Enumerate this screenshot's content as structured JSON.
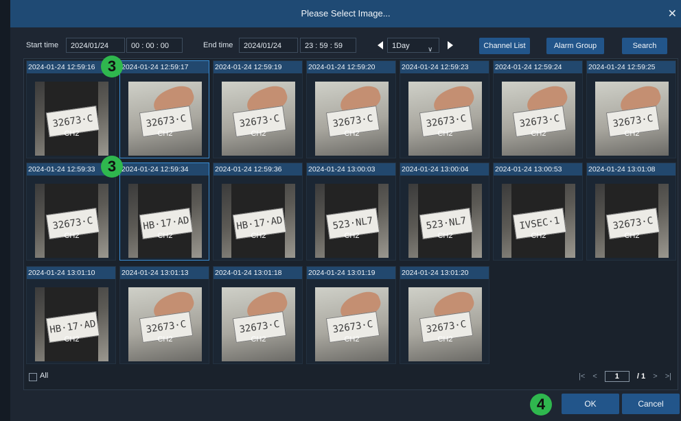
{
  "dialog": {
    "title": "Please Select Image...",
    "close_icon": "close-icon"
  },
  "toolbar": {
    "start_label": "Start time",
    "start_date": "2024/01/24",
    "start_time": "00  :  00  :  00",
    "end_label": "End time",
    "end_date": "2024/01/24",
    "end_time": "23  :  59  :  59",
    "range_value": "1Day",
    "channel_list": "Channel List",
    "alarm_group": "Alarm Group",
    "search": "Search"
  },
  "images": [
    {
      "ts": "2024-01-24 12:59:16",
      "ch": "CH2",
      "plate": "32673·C",
      "scene": "dark"
    },
    {
      "ts": "2024-01-24 12:59:17",
      "ch": "CH2",
      "plate": "32673·C",
      "scene": "light",
      "selected": true
    },
    {
      "ts": "2024-01-24 12:59:19",
      "ch": "CH2",
      "plate": "32673·C",
      "scene": "light"
    },
    {
      "ts": "2024-01-24 12:59:20",
      "ch": "CH2",
      "plate": "32673·C",
      "scene": "light"
    },
    {
      "ts": "2024-01-24 12:59:23",
      "ch": "CH2",
      "plate": "32673·C",
      "scene": "light"
    },
    {
      "ts": "2024-01-24 12:59:24",
      "ch": "CH2",
      "plate": "32673·C",
      "scene": "light"
    },
    {
      "ts": "2024-01-24 12:59:25",
      "ch": "CH2",
      "plate": "32673·C",
      "scene": "light"
    },
    {
      "ts": "2024-01-24 12:59:33",
      "ch": "CH2",
      "plate": "32673·C",
      "scene": "dark"
    },
    {
      "ts": "2024-01-24 12:59:34",
      "ch": "CH2",
      "plate": "HB·17·AD",
      "scene": "dark",
      "selected": true
    },
    {
      "ts": "2024-01-24 12:59:36",
      "ch": "CH2",
      "plate": "HB·17·AD",
      "scene": "dark"
    },
    {
      "ts": "2024-01-24 13:00:03",
      "ch": "CH2",
      "plate": "523·NL7",
      "scene": "dark"
    },
    {
      "ts": "2024-01-24 13:00:04",
      "ch": "CH2",
      "plate": "523·NL7",
      "scene": "dark"
    },
    {
      "ts": "2024-01-24 13:00:53",
      "ch": "CH2",
      "plate": "IVSEC·1",
      "scene": "dark"
    },
    {
      "ts": "2024-01-24 13:01:08",
      "ch": "CH2",
      "plate": "32673·C",
      "scene": "dark"
    },
    {
      "ts": "2024-01-24 13:01:10",
      "ch": "CH2",
      "plate": "HB·17·AD",
      "scene": "dark"
    },
    {
      "ts": "2024-01-24 13:01:13",
      "ch": "CH2",
      "plate": "32673·C",
      "scene": "light"
    },
    {
      "ts": "2024-01-24 13:01:18",
      "ch": "CH2",
      "plate": "32673·C",
      "scene": "light"
    },
    {
      "ts": "2024-01-24 13:01:19",
      "ch": "CH2",
      "plate": "32673·C",
      "scene": "light"
    },
    {
      "ts": "2024-01-24 13:01:20",
      "ch": "CH2",
      "plate": "32673·C",
      "scene": "light"
    }
  ],
  "footer": {
    "all_label": "All",
    "page_current": "1",
    "page_total": "/ 1"
  },
  "actions": {
    "ok": "OK",
    "cancel": "Cancel"
  },
  "badges": {
    "step3": "3",
    "step4": "4"
  },
  "colors": {
    "accent": "#22558a",
    "titlebar": "#1f4a74",
    "badge": "#2fb74e",
    "selected_border": "#3a8ed6"
  }
}
